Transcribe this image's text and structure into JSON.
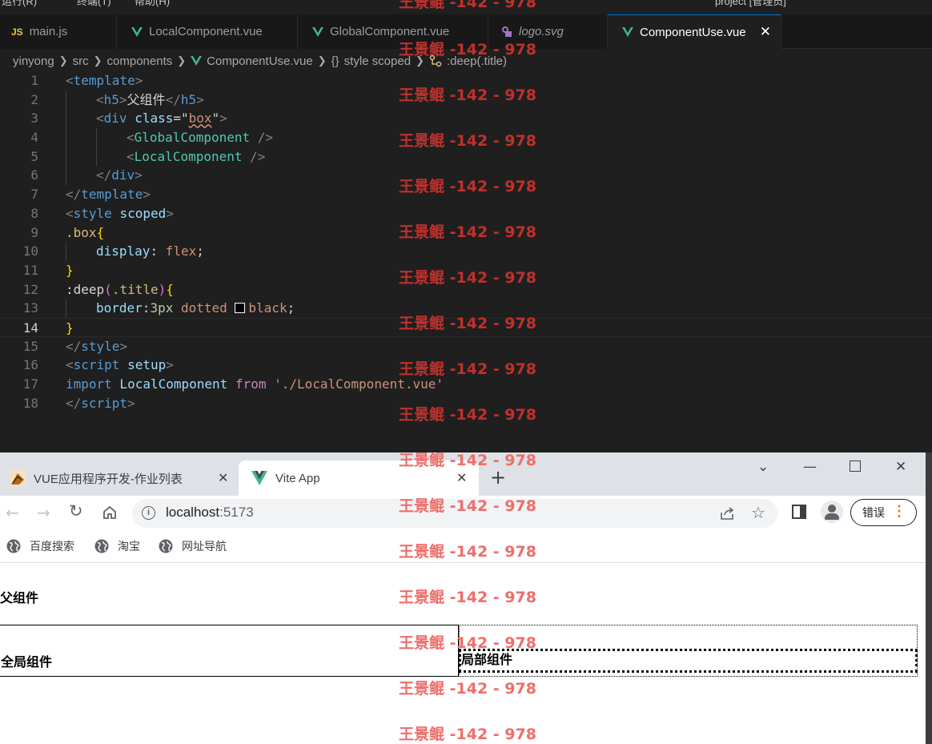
{
  "editor": {
    "menubar": {
      "items": [
        "运行(R)",
        "终端(T)",
        "帮助(H)"
      ],
      "project_title": "project [管理员]"
    },
    "tabs": [
      {
        "label": "main.js",
        "icon": "js-icon"
      },
      {
        "label": "LocalComponent.vue",
        "icon": "vue-icon"
      },
      {
        "label": "GlobalComponent.vue",
        "icon": "vue-icon"
      },
      {
        "label": "logo.svg",
        "icon": "svg-icon"
      },
      {
        "label": "ComponentUse.vue",
        "icon": "vue-icon",
        "active": true
      }
    ],
    "breadcrumb": [
      "yinyong",
      "src",
      "components",
      "ComponentUse.vue",
      "style scoped",
      ":deep(.title)"
    ],
    "line_numbers": [
      "1",
      "2",
      "3",
      "4",
      "5",
      "6",
      "7",
      "8",
      "9",
      "10",
      "11",
      "12",
      "13",
      "14",
      "15",
      "16",
      "17",
      "18"
    ],
    "current_line": "14",
    "code": {
      "l1": {
        "open": "<",
        "tag": "template",
        "close": ">"
      },
      "l2": {
        "open": "<",
        "tag": "h5",
        "close": ">",
        "text": "父组件",
        "end_open": "</",
        "end_tag": "h5",
        "end_close": ">"
      },
      "l3": {
        "open": "<",
        "tag": "div",
        "attr": "class",
        "eq": "=\"",
        "val": "box",
        "q": "\"",
        "close": ">"
      },
      "l4": {
        "open": "<",
        "comp": "GlobalComponent",
        "close": " />"
      },
      "l5": {
        "open": "<",
        "comp": "LocalComponent",
        "close": " />"
      },
      "l6": {
        "open": "</",
        "tag": "div",
        "close": ">"
      },
      "l7": {
        "open": "</",
        "tag": "template",
        "close": ">"
      },
      "l8": {
        "open": "<",
        "tag": "style",
        "attr": " scoped",
        "close": ">"
      },
      "l9": {
        "sel": ".box",
        "brace": "{"
      },
      "l10": {
        "prop": "display",
        "colon": ": ",
        "val": "flex",
        "semi": ";"
      },
      "l11": {
        "brace": "}"
      },
      "l12": {
        "sel": ":deep",
        "paren_open": "(",
        "inner": ".title",
        "paren_close": ")",
        "brace": "{"
      },
      "l13": {
        "prop": "border",
        "colon": ":",
        "num": "3px",
        "val1": " dotted ",
        "val2": "black",
        "semi": ";"
      },
      "l14": {
        "brace": "}"
      },
      "l15": {
        "open": "</",
        "tag": "style",
        "close": ">"
      },
      "l16": {
        "open": "<",
        "tag": "script",
        "attr": " setup",
        "close": ">"
      },
      "l17": {
        "kw1": "import",
        "ident": " LocalComponent ",
        "kw2": "from",
        "str": " './LocalComponent.vue'"
      },
      "l18": {
        "open": "</",
        "tag": "script",
        "close": ">"
      }
    }
  },
  "browser": {
    "tabs": [
      {
        "label": "VUE应用程序开发-作业列表",
        "active": false
      },
      {
        "label": "Vite App",
        "active": true
      }
    ],
    "new_tab": "+",
    "url_host": "localhost",
    "url_port": ":5173",
    "error_button": "错误",
    "bookmarks": [
      "百度搜索",
      "淘宝",
      "网址导航"
    ]
  },
  "page": {
    "heading": "父组件",
    "global_title": "全局组件",
    "local_title": "局部组件"
  },
  "watermark": {
    "text": "王景鲲 -142 - 978"
  },
  "colors": {
    "editor_bg": "#1f1f1f",
    "tab_active_border": "#0078d4",
    "watermark_dark": "#c0302c",
    "watermark_light": "#ef6e6a"
  }
}
